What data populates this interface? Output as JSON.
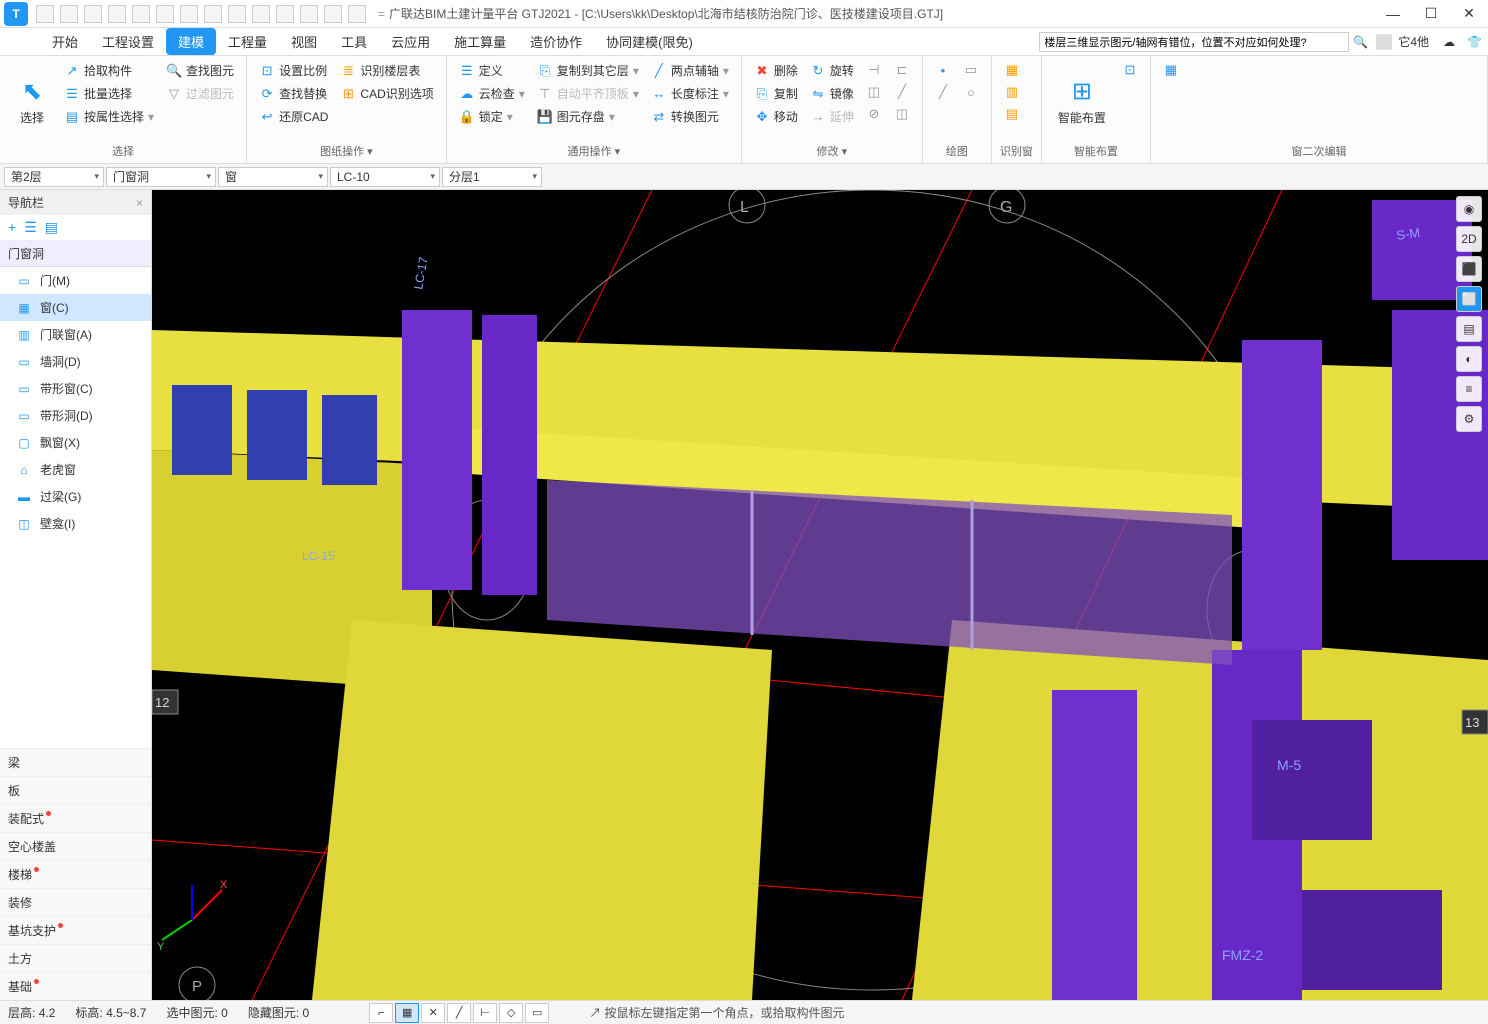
{
  "title": "广联达BIM土建计量平台 GTJ2021 - [C:\\Users\\kk\\Desktop\\北海市结核防治院门诊、医技楼建设项目.GTJ]",
  "logo": "T",
  "menu": {
    "items": [
      "开始",
      "工程设置",
      "建模",
      "工程量",
      "视图",
      "工具",
      "云应用",
      "施工算量",
      "造价协作",
      "协同建模(限免)"
    ],
    "active": "建模"
  },
  "search": {
    "placeholder": "楼层三维显示图元/轴网有错位，位置不对应如何处理?"
  },
  "user": {
    "label": "它4他"
  },
  "ribbon": {
    "select": {
      "label": "选择",
      "big": "选择",
      "items": [
        "拾取构件",
        "批量选择",
        "按属性选择"
      ],
      "filter": [
        "查找图元",
        "过滤图元"
      ]
    },
    "drawing": {
      "label": "图纸操作",
      "items1": [
        "设置比例",
        "查找替换",
        "还原CAD"
      ],
      "items2": [
        "识别楼层表",
        "CAD识别选项"
      ]
    },
    "common": {
      "label": "通用操作",
      "items1": [
        "定义",
        "云检查",
        "锁定"
      ],
      "items2": [
        "复制到其它层",
        "自动平齐顶板",
        "图元存盘"
      ],
      "items3": [
        "两点辅轴",
        "长度标注",
        "转换图元"
      ]
    },
    "modify": {
      "label": "修改",
      "items1": [
        "删除",
        "复制",
        "移动"
      ],
      "items2": [
        "旋转",
        "镜像",
        "延伸"
      ]
    },
    "draw": {
      "label": "绘图"
    },
    "recognize": {
      "label": "识别窗"
    },
    "smart": {
      "label": "智能布置",
      "big": "智能布置"
    },
    "edit2": {
      "label": "窗二次编辑"
    }
  },
  "dropdowns": {
    "floor": "第2层",
    "category": "门窗洞",
    "component": "窗",
    "code": "LC-10",
    "layer": "分层1"
  },
  "nav": {
    "title": "导航栏",
    "section": "门窗洞",
    "items": [
      {
        "label": "门(M)",
        "icon": "▭"
      },
      {
        "label": "窗(C)",
        "icon": "▦",
        "active": true
      },
      {
        "label": "门联窗(A)",
        "icon": "▥"
      },
      {
        "label": "墙洞(D)",
        "icon": "▭"
      },
      {
        "label": "带形窗(C)",
        "icon": "▭"
      },
      {
        "label": "带形洞(D)",
        "icon": "▭"
      },
      {
        "label": "飘窗(X)",
        "icon": "▢"
      },
      {
        "label": "老虎窗",
        "icon": "⌂"
      },
      {
        "label": "过梁(G)",
        "icon": "▬"
      },
      {
        "label": "壁龛(I)",
        "icon": "◫"
      }
    ],
    "categories": [
      {
        "label": "梁"
      },
      {
        "label": "板"
      },
      {
        "label": "装配式",
        "dot": true
      },
      {
        "label": "空心楼盖"
      },
      {
        "label": "楼梯",
        "dot": true
      },
      {
        "label": "装修"
      },
      {
        "label": "基坑支护",
        "dot": true
      },
      {
        "label": "土方"
      },
      {
        "label": "基础",
        "dot": true
      }
    ]
  },
  "viewport": {
    "axes": {
      "L": "L",
      "G": "G",
      "P": "P",
      "n12": "12",
      "n13": "13"
    },
    "labels": {
      "m5": "M-5",
      "s-m": "S-M",
      "fmz": "FMZ-2",
      "lc15": "LC-15",
      "lc17": "LC-17"
    }
  },
  "status": {
    "floor_h_label": "层高:",
    "floor_h": "4.2",
    "elev_label": "标高:",
    "elev": "4.5~8.7",
    "selected_label": "选中图元:",
    "selected": "0",
    "hidden_label": "隐藏图元:",
    "hidden": "0",
    "hint": "按鼠标左键指定第一个角点，或拾取构件图元"
  }
}
